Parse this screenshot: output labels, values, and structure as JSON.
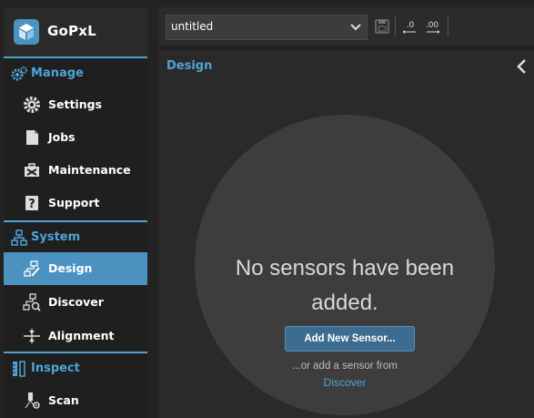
{
  "app": {
    "logo_text": "GoPxL"
  },
  "sidebar": {
    "sections": [
      {
        "label": "Manage",
        "items": [
          "Settings",
          "Jobs",
          "Maintenance",
          "Support"
        ]
      },
      {
        "label": "System",
        "items": [
          "Design",
          "Discover",
          "Alignment"
        ]
      },
      {
        "label": "Inspect",
        "items": [
          "Scan"
        ]
      }
    ],
    "active_item": "Design"
  },
  "toolbar": {
    "job_select_value": "untitled",
    "icons": [
      "save-icon",
      "decimal-decrease-icon",
      "decimal-increase-icon"
    ],
    "decimal_decrease_label": ".0",
    "decimal_increase_label": ".00"
  },
  "panel": {
    "title": "Design",
    "empty_message": "No sensors have been added.",
    "add_button_label": "Add New Sensor...",
    "or_text": "...or add a sensor from",
    "discover_link": "Discover"
  },
  "colors": {
    "accent": "#4fa3d6",
    "active_nav_bg": "#4c92c1",
    "add_button_bg": "#3c6c8f",
    "panel_bg": "#2a2a2a",
    "circle_bg": "#3d3d3d"
  }
}
